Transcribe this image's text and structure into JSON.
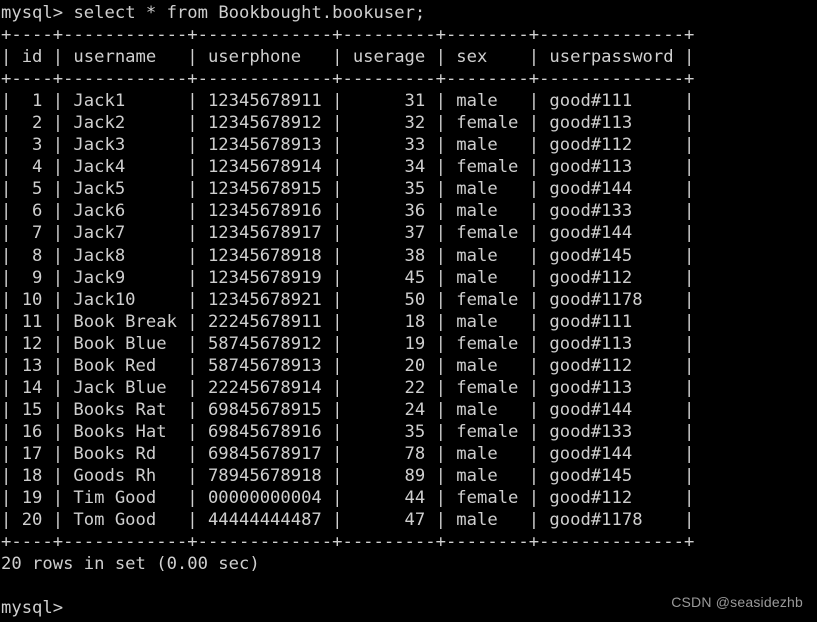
{
  "terminal": {
    "prompt": "mysql>",
    "command": "select * from Bookbought.bookuser;",
    "result_status": "20 rows in set (0.00 sec)",
    "final_prompt": "mysql>",
    "watermark": "CSDN @seasidezhb",
    "foreground_color": "#cfcfcf",
    "background_color": "#000000",
    "watermark_color": "#9a9a9a"
  },
  "table": {
    "columns": [
      {
        "name": "id",
        "width": 4,
        "align": "right"
      },
      {
        "name": "username",
        "width": 12,
        "align": "left"
      },
      {
        "name": "userphone",
        "width": 13,
        "align": "left"
      },
      {
        "name": "userage",
        "width": 9,
        "align": "right"
      },
      {
        "name": "sex",
        "width": 8,
        "align": "left"
      },
      {
        "name": "userpassword",
        "width": 14,
        "align": "left"
      }
    ],
    "headers": [
      "id",
      "username",
      "userphone",
      "userage",
      "sex",
      "userpassword"
    ],
    "rows": [
      [
        "1",
        "Jack1",
        "12345678911",
        "31",
        "male",
        "good#111"
      ],
      [
        "2",
        "Jack2",
        "12345678912",
        "32",
        "female",
        "good#113"
      ],
      [
        "3",
        "Jack3",
        "12345678913",
        "33",
        "male",
        "good#112"
      ],
      [
        "4",
        "Jack4",
        "12345678914",
        "34",
        "female",
        "good#113"
      ],
      [
        "5",
        "Jack5",
        "12345678915",
        "35",
        "male",
        "good#144"
      ],
      [
        "6",
        "Jack6",
        "12345678916",
        "36",
        "male",
        "good#133"
      ],
      [
        "7",
        "Jack7",
        "12345678917",
        "37",
        "female",
        "good#144"
      ],
      [
        "8",
        "Jack8",
        "12345678918",
        "38",
        "male",
        "good#145"
      ],
      [
        "9",
        "Jack9",
        "12345678919",
        "45",
        "male",
        "good#112"
      ],
      [
        "10",
        "Jack10",
        "12345678921",
        "50",
        "female",
        "good#1178"
      ],
      [
        "11",
        "Book Break",
        "22245678911",
        "18",
        "male",
        "good#111"
      ],
      [
        "12",
        "Book Blue",
        "58745678912",
        "19",
        "female",
        "good#113"
      ],
      [
        "13",
        "Book Red",
        "58745678913",
        "20",
        "male",
        "good#112"
      ],
      [
        "14",
        "Jack Blue",
        "22245678914",
        "22",
        "female",
        "good#113"
      ],
      [
        "15",
        "Books Rat",
        "69845678915",
        "24",
        "male",
        "good#144"
      ],
      [
        "16",
        "Books Hat",
        "69845678916",
        "35",
        "female",
        "good#133"
      ],
      [
        "17",
        "Books Rd",
        "69845678917",
        "78",
        "male",
        "good#144"
      ],
      [
        "18",
        "Goods Rh",
        "78945678918",
        "89",
        "male",
        "good#145"
      ],
      [
        "19",
        "Tim Good",
        "00000000004",
        "44",
        "female",
        "good#112"
      ],
      [
        "20",
        "Tom Good",
        "44444444487",
        "47",
        "male",
        "good#1178"
      ]
    ],
    "row_count": 20
  }
}
